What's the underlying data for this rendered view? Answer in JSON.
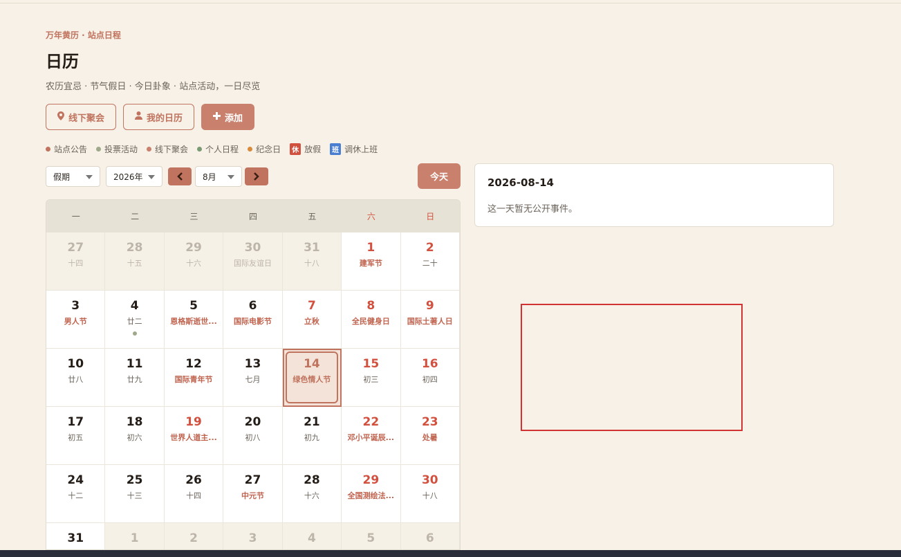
{
  "header": {
    "kicker": "万年黄历 · 站点日程",
    "title": "日历",
    "subtitle": "农历宜忌 · 节气假日 · 今日卦象 · 站点活动，一日尽览"
  },
  "buttons": {
    "offline": "线下聚会",
    "mycal": "我的日历",
    "add": "添加"
  },
  "legend": [
    {
      "label": "站点公告",
      "color": "#c0735e"
    },
    {
      "label": "投票活动",
      "color": "#a0a88a"
    },
    {
      "label": "线下聚会",
      "color": "#c9806c"
    },
    {
      "label": "个人日程",
      "color": "#7a9a72"
    },
    {
      "label": "纪念日",
      "color": "#d98a3a"
    }
  ],
  "tags": {
    "holiday": "休",
    "holiday_label": "放假",
    "work": "班",
    "work_label": "调休上班"
  },
  "controls": {
    "mode": "假期",
    "year": "2026年",
    "month": "8月",
    "today": "今天",
    "prev": "‹",
    "next": "›"
  },
  "weekdays": [
    "一",
    "二",
    "三",
    "四",
    "五",
    "六",
    "日"
  ],
  "days": [
    {
      "n": "27",
      "s": "十四",
      "o": true
    },
    {
      "n": "28",
      "s": "十五",
      "o": true
    },
    {
      "n": "29",
      "s": "十六",
      "o": true
    },
    {
      "n": "30",
      "s": "国际友谊日",
      "o": true
    },
    {
      "n": "31",
      "s": "十八",
      "o": true
    },
    {
      "n": "1",
      "s": "建军节",
      "w": true,
      "f": true
    },
    {
      "n": "2",
      "s": "二十",
      "w": true
    },
    {
      "n": "3",
      "s": "男人节",
      "f": true
    },
    {
      "n": "4",
      "s": "廿二",
      "dot": true
    },
    {
      "n": "5",
      "s": "恩格斯逝世...",
      "f": true
    },
    {
      "n": "6",
      "s": "国际电影节",
      "f": true
    },
    {
      "n": "7",
      "s": "立秋",
      "w": true,
      "f": true
    },
    {
      "n": "8",
      "s": "全民健身日",
      "w": true,
      "f": true
    },
    {
      "n": "9",
      "s": "国际土著人日",
      "w": true,
      "f": true
    },
    {
      "n": "10",
      "s": "廿八"
    },
    {
      "n": "11",
      "s": "廿九"
    },
    {
      "n": "12",
      "s": "国际青年节",
      "f": true
    },
    {
      "n": "13",
      "s": "七月"
    },
    {
      "n": "14",
      "s": "绿色情人节",
      "sel": true
    },
    {
      "n": "15",
      "s": "初三",
      "w": true
    },
    {
      "n": "16",
      "s": "初四",
      "w": true
    },
    {
      "n": "17",
      "s": "初五"
    },
    {
      "n": "18",
      "s": "初六"
    },
    {
      "n": "19",
      "s": "世界人道主...",
      "w2": true,
      "f": true
    },
    {
      "n": "20",
      "s": "初八"
    },
    {
      "n": "21",
      "s": "初九"
    },
    {
      "n": "22",
      "s": "邓小平诞辰...",
      "w": true,
      "f": true
    },
    {
      "n": "23",
      "s": "处暑",
      "w": true,
      "f": true
    },
    {
      "n": "24",
      "s": "十二"
    },
    {
      "n": "25",
      "s": "十三"
    },
    {
      "n": "26",
      "s": "十四"
    },
    {
      "n": "27",
      "s": "中元节",
      "f": true
    },
    {
      "n": "28",
      "s": "十六"
    },
    {
      "n": "29",
      "s": "全国测绘法...",
      "w": true,
      "f": true
    },
    {
      "n": "30",
      "s": "十八",
      "w": true
    },
    {
      "n": "31",
      "s": ""
    },
    {
      "n": "1",
      "s": "",
      "o": true
    },
    {
      "n": "2",
      "s": "",
      "o": true
    },
    {
      "n": "3",
      "s": "",
      "o": true
    },
    {
      "n": "4",
      "s": "",
      "o": true
    },
    {
      "n": "5",
      "s": "",
      "o": true
    },
    {
      "n": "6",
      "s": "",
      "o": true
    }
  ],
  "detail": {
    "date": "2026-08-14",
    "message": "这一天暂无公开事件。"
  }
}
